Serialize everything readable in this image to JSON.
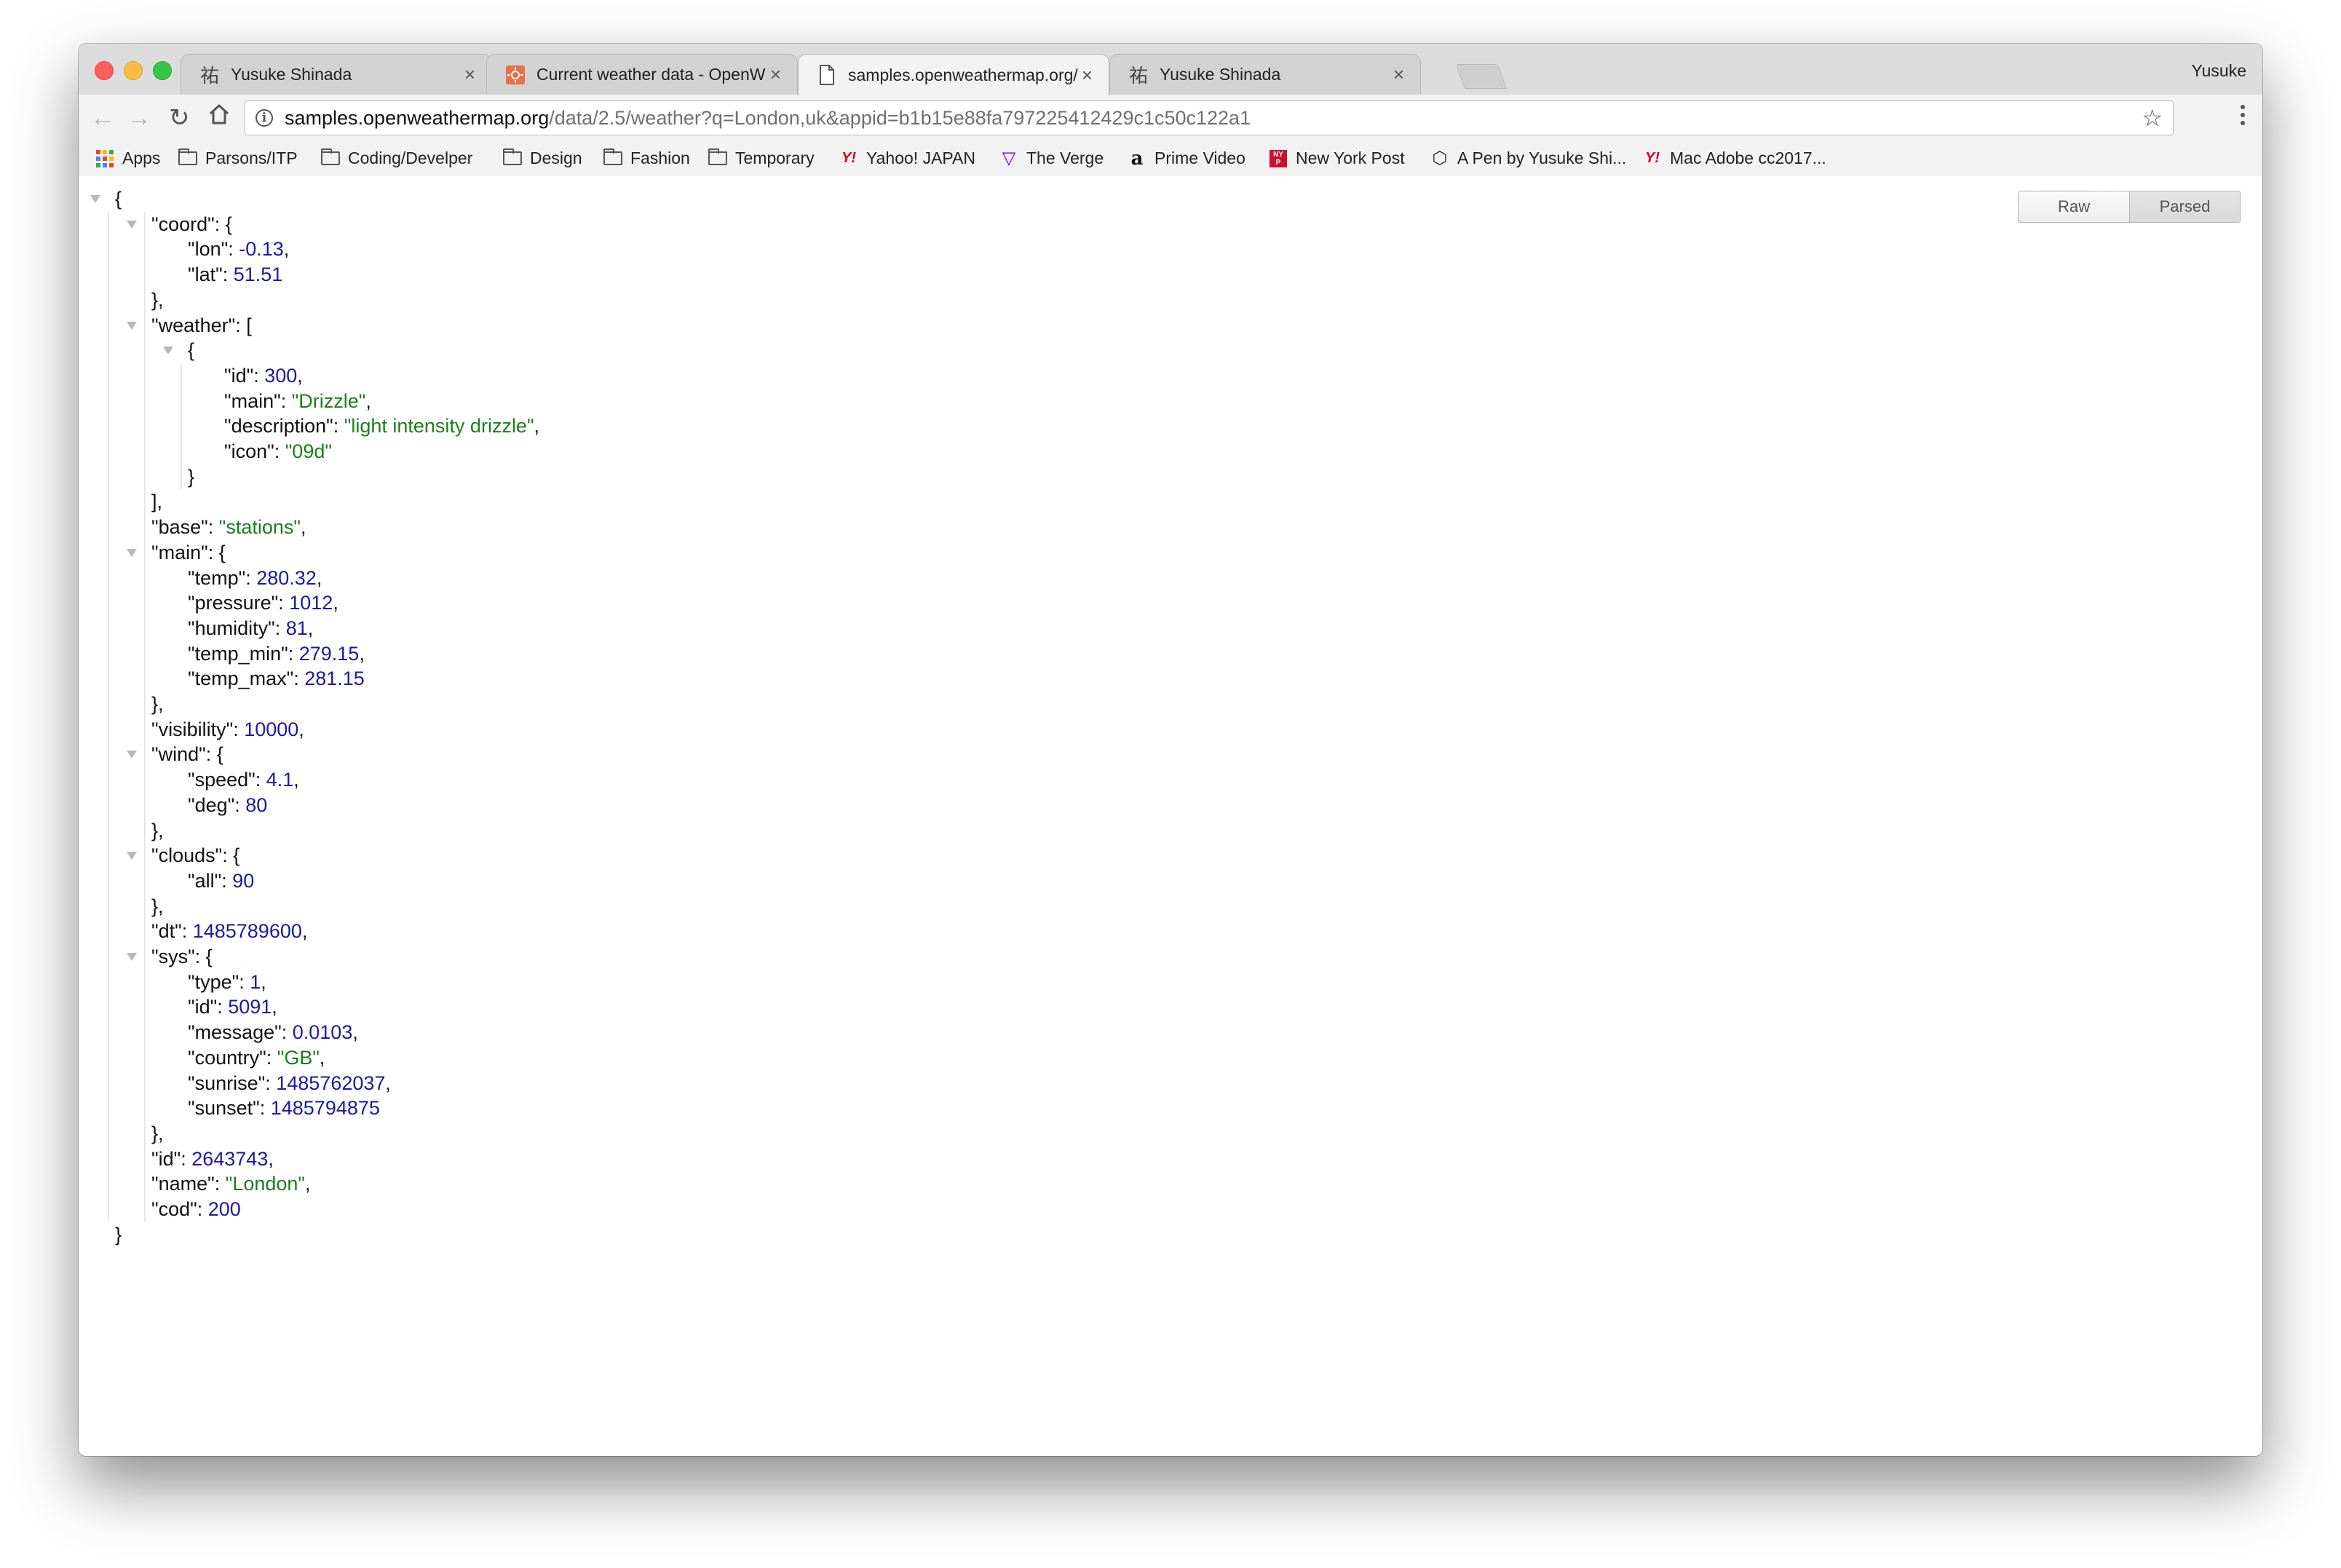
{
  "browser": {
    "profile_name": "Yusuke",
    "tabs": [
      {
        "title": "Yusuke Shinada",
        "favicon": "kanji-favicon-icon",
        "active": false
      },
      {
        "title": "Current weather data - OpenW",
        "favicon": "openweather-favicon-icon",
        "active": false
      },
      {
        "title": "samples.openweathermap.org/",
        "favicon": "document-icon",
        "active": true
      },
      {
        "title": "Yusuke Shinada",
        "favicon": "kanji-favicon-icon",
        "active": false
      }
    ],
    "address_bar": {
      "host": "samples.openweathermap.org",
      "path": "/data/2.5/weather?q=London,uk&appid=b1b15e88fa797225412429c1c50c122a1"
    },
    "bookmarks": [
      {
        "label": "Apps",
        "icon": "apps-grid-icon"
      },
      {
        "label": "Parsons/ITP",
        "icon": "folder-icon"
      },
      {
        "label": "Coding/Develper",
        "icon": "folder-icon"
      },
      {
        "label": "Design",
        "icon": "folder-icon"
      },
      {
        "label": "Fashion",
        "icon": "folder-icon"
      },
      {
        "label": "Temporary",
        "icon": "folder-icon"
      },
      {
        "label": "Yahoo! JAPAN",
        "icon": "yahoo-icon"
      },
      {
        "label": "The Verge",
        "icon": "verge-icon"
      },
      {
        "label": "Prime Video",
        "icon": "amazon-icon"
      },
      {
        "label": "New York Post",
        "icon": "nypost-icon"
      },
      {
        "label": "A Pen by Yusuke Shi...",
        "icon": "codepen-icon"
      },
      {
        "label": "Mac Adobe cc2017...",
        "icon": "yahoo-icon"
      }
    ]
  },
  "viewer": {
    "raw_label": "Raw",
    "parsed_label": "Parsed"
  },
  "json_lines": [
    {
      "d": 0,
      "tri": true,
      "t": [
        [
          "p",
          "{"
        ]
      ]
    },
    {
      "d": 1,
      "tri": true,
      "t": [
        [
          "k",
          "\"coord\""
        ],
        [
          "p",
          ": {"
        ]
      ]
    },
    {
      "d": 2,
      "t": [
        [
          "k",
          "\"lon\""
        ],
        [
          "p",
          ": "
        ],
        [
          "n",
          "-0.13"
        ],
        [
          "p",
          ","
        ]
      ]
    },
    {
      "d": 2,
      "t": [
        [
          "k",
          "\"lat\""
        ],
        [
          "p",
          ": "
        ],
        [
          "n",
          "51.51"
        ]
      ]
    },
    {
      "d": 1,
      "t": [
        [
          "p",
          "},"
        ]
      ]
    },
    {
      "d": 1,
      "tri": true,
      "t": [
        [
          "k",
          "\"weather\""
        ],
        [
          "p",
          ": ["
        ]
      ]
    },
    {
      "d": 2,
      "tri": true,
      "t": [
        [
          "p",
          "{"
        ]
      ]
    },
    {
      "d": 3,
      "t": [
        [
          "k",
          "\"id\""
        ],
        [
          "p",
          ": "
        ],
        [
          "n",
          "300"
        ],
        [
          "p",
          ","
        ]
      ]
    },
    {
      "d": 3,
      "t": [
        [
          "k",
          "\"main\""
        ],
        [
          "p",
          ": "
        ],
        [
          "s",
          "\"Drizzle\""
        ],
        [
          "p",
          ","
        ]
      ]
    },
    {
      "d": 3,
      "t": [
        [
          "k",
          "\"description\""
        ],
        [
          "p",
          ": "
        ],
        [
          "s",
          "\"light intensity drizzle\""
        ],
        [
          "p",
          ","
        ]
      ]
    },
    {
      "d": 3,
      "t": [
        [
          "k",
          "\"icon\""
        ],
        [
          "p",
          ": "
        ],
        [
          "s",
          "\"09d\""
        ]
      ]
    },
    {
      "d": 2,
      "t": [
        [
          "p",
          "}"
        ]
      ]
    },
    {
      "d": 1,
      "t": [
        [
          "p",
          "],"
        ]
      ]
    },
    {
      "d": 1,
      "t": [
        [
          "k",
          "\"base\""
        ],
        [
          "p",
          ": "
        ],
        [
          "s",
          "\"stations\""
        ],
        [
          "p",
          ","
        ]
      ]
    },
    {
      "d": 1,
      "tri": true,
      "t": [
        [
          "k",
          "\"main\""
        ],
        [
          "p",
          ": {"
        ]
      ]
    },
    {
      "d": 2,
      "t": [
        [
          "k",
          "\"temp\""
        ],
        [
          "p",
          ": "
        ],
        [
          "n",
          "280.32"
        ],
        [
          "p",
          ","
        ]
      ]
    },
    {
      "d": 2,
      "t": [
        [
          "k",
          "\"pressure\""
        ],
        [
          "p",
          ": "
        ],
        [
          "n",
          "1012"
        ],
        [
          "p",
          ","
        ]
      ]
    },
    {
      "d": 2,
      "t": [
        [
          "k",
          "\"humidity\""
        ],
        [
          "p",
          ": "
        ],
        [
          "n",
          "81"
        ],
        [
          "p",
          ","
        ]
      ]
    },
    {
      "d": 2,
      "t": [
        [
          "k",
          "\"temp_min\""
        ],
        [
          "p",
          ": "
        ],
        [
          "n",
          "279.15"
        ],
        [
          "p",
          ","
        ]
      ]
    },
    {
      "d": 2,
      "t": [
        [
          "k",
          "\"temp_max\""
        ],
        [
          "p",
          ": "
        ],
        [
          "n",
          "281.15"
        ]
      ]
    },
    {
      "d": 1,
      "t": [
        [
          "p",
          "},"
        ]
      ]
    },
    {
      "d": 1,
      "t": [
        [
          "k",
          "\"visibility\""
        ],
        [
          "p",
          ": "
        ],
        [
          "n",
          "10000"
        ],
        [
          "p",
          ","
        ]
      ]
    },
    {
      "d": 1,
      "tri": true,
      "t": [
        [
          "k",
          "\"wind\""
        ],
        [
          "p",
          ": {"
        ]
      ]
    },
    {
      "d": 2,
      "t": [
        [
          "k",
          "\"speed\""
        ],
        [
          "p",
          ": "
        ],
        [
          "n",
          "4.1"
        ],
        [
          "p",
          ","
        ]
      ]
    },
    {
      "d": 2,
      "t": [
        [
          "k",
          "\"deg\""
        ],
        [
          "p",
          ": "
        ],
        [
          "n",
          "80"
        ]
      ]
    },
    {
      "d": 1,
      "t": [
        [
          "p",
          "},"
        ]
      ]
    },
    {
      "d": 1,
      "tri": true,
      "t": [
        [
          "k",
          "\"clouds\""
        ],
        [
          "p",
          ": {"
        ]
      ]
    },
    {
      "d": 2,
      "t": [
        [
          "k",
          "\"all\""
        ],
        [
          "p",
          ": "
        ],
        [
          "n",
          "90"
        ]
      ]
    },
    {
      "d": 1,
      "t": [
        [
          "p",
          "},"
        ]
      ]
    },
    {
      "d": 1,
      "t": [
        [
          "k",
          "\"dt\""
        ],
        [
          "p",
          ": "
        ],
        [
          "n",
          "1485789600"
        ],
        [
          "p",
          ","
        ]
      ]
    },
    {
      "d": 1,
      "tri": true,
      "t": [
        [
          "k",
          "\"sys\""
        ],
        [
          "p",
          ": {"
        ]
      ]
    },
    {
      "d": 2,
      "t": [
        [
          "k",
          "\"type\""
        ],
        [
          "p",
          ": "
        ],
        [
          "n",
          "1"
        ],
        [
          "p",
          ","
        ]
      ]
    },
    {
      "d": 2,
      "t": [
        [
          "k",
          "\"id\""
        ],
        [
          "p",
          ": "
        ],
        [
          "n",
          "5091"
        ],
        [
          "p",
          ","
        ]
      ]
    },
    {
      "d": 2,
      "t": [
        [
          "k",
          "\"message\""
        ],
        [
          "p",
          ": "
        ],
        [
          "n",
          "0.0103"
        ],
        [
          "p",
          ","
        ]
      ]
    },
    {
      "d": 2,
      "t": [
        [
          "k",
          "\"country\""
        ],
        [
          "p",
          ": "
        ],
        [
          "s",
          "\"GB\""
        ],
        [
          "p",
          ","
        ]
      ]
    },
    {
      "d": 2,
      "t": [
        [
          "k",
          "\"sunrise\""
        ],
        [
          "p",
          ": "
        ],
        [
          "n",
          "1485762037"
        ],
        [
          "p",
          ","
        ]
      ]
    },
    {
      "d": 2,
      "t": [
        [
          "k",
          "\"sunset\""
        ],
        [
          "p",
          ": "
        ],
        [
          "n",
          "1485794875"
        ]
      ]
    },
    {
      "d": 1,
      "t": [
        [
          "p",
          "},"
        ]
      ]
    },
    {
      "d": 1,
      "t": [
        [
          "k",
          "\"id\""
        ],
        [
          "p",
          ": "
        ],
        [
          "n",
          "2643743"
        ],
        [
          "p",
          ","
        ]
      ]
    },
    {
      "d": 1,
      "t": [
        [
          "k",
          "\"name\""
        ],
        [
          "p",
          ": "
        ],
        [
          "s",
          "\"London\""
        ],
        [
          "p",
          ","
        ]
      ]
    },
    {
      "d": 1,
      "t": [
        [
          "k",
          "\"cod\""
        ],
        [
          "p",
          ": "
        ],
        [
          "n",
          "200"
        ]
      ]
    },
    {
      "d": 0,
      "t": [
        [
          "p",
          "}"
        ]
      ]
    }
  ]
}
